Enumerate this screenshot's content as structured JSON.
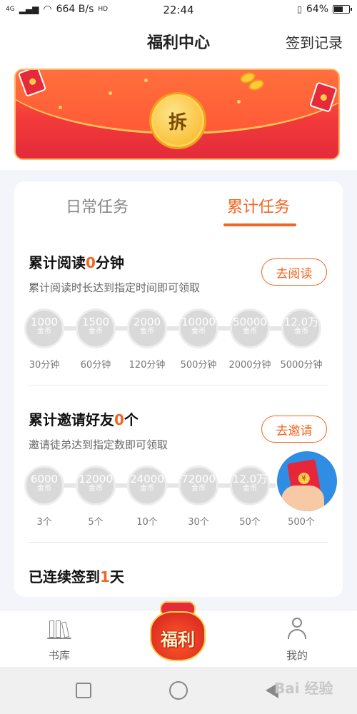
{
  "status_bar": {
    "signal": "4G",
    "speed": "664 B/s",
    "hd": "HD",
    "time": "22:44",
    "battery": "64%",
    "battery_level": 0.64
  },
  "header": {
    "title": "福利中心",
    "sign_record": "签到记录"
  },
  "banner": {
    "button_label": "拆"
  },
  "tabs": {
    "daily": "日常任务",
    "accumulated": "累计任务",
    "active": "accumulated"
  },
  "reading": {
    "title_prefix": "累计阅读",
    "count": "0",
    "title_suffix": "分钟",
    "desc": "累计阅读时长达到指定时间即可领取",
    "button": "去阅读",
    "rewards": [
      {
        "amount": "1000",
        "unit": "金币",
        "req": "30分钟"
      },
      {
        "amount": "1500",
        "unit": "金币",
        "req": "60分钟"
      },
      {
        "amount": "2000",
        "unit": "金币",
        "req": "120分钟"
      },
      {
        "amount": "10000",
        "unit": "金币",
        "req": "500分钟"
      },
      {
        "amount": "50000",
        "unit": "金币",
        "req": "2000分钟"
      },
      {
        "amount": "12.0万",
        "unit": "金币",
        "req": "5000分钟"
      }
    ]
  },
  "invite": {
    "title_prefix": "累计邀请好友",
    "count": "0",
    "title_suffix": "个",
    "desc": "邀请徒弟达到指定数即可领取",
    "button": "去邀请",
    "rewards": [
      {
        "amount": "6000",
        "unit": "金币",
        "req": "3个"
      },
      {
        "amount": "12000",
        "unit": "金币",
        "req": "5个"
      },
      {
        "amount": "24000",
        "unit": "金币",
        "req": "10个"
      },
      {
        "amount": "72000",
        "unit": "金币",
        "req": "30个"
      },
      {
        "amount": "12.0万",
        "unit": "金币",
        "req": "50个"
      },
      {
        "amount": "",
        "unit": "",
        "req": "500个"
      }
    ]
  },
  "signin": {
    "title_prefix": "已连续签到",
    "count": "1",
    "title_suffix": "天"
  },
  "bottom_nav": {
    "books": "书库",
    "fuli": "福利",
    "mine": "我的"
  },
  "watermark": "Bai 经验"
}
